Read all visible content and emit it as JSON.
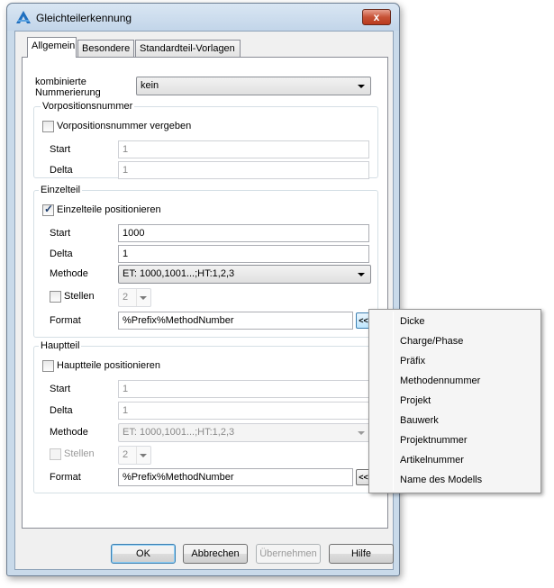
{
  "window": {
    "title": "Gleichteilerkennung",
    "close_glyph": "x"
  },
  "tabs": [
    {
      "label": "Allgemein"
    },
    {
      "label": "Besondere"
    },
    {
      "label": "Standardteil-Vorlagen"
    }
  ],
  "general": {
    "numbering_label": "kombinierte Nummerierung",
    "numbering_value": "kein"
  },
  "pre_position": {
    "group_title": "Vorpositionsnummer",
    "checkbox_label": "Vorpositionsnummer vergeben",
    "checked": false,
    "start_label": "Start",
    "start_value": "1",
    "delta_label": "Delta",
    "delta_value": "1"
  },
  "single_part": {
    "group_title": "Einzelteil",
    "checkbox_label": "Einzelteile positionieren",
    "checked": true,
    "start_label": "Start",
    "start_value": "1000",
    "delta_label": "Delta",
    "delta_value": "1",
    "method_label": "Methode",
    "method_value": "ET: 1000,1001...;HT:1,2,3",
    "digits_label": "Stellen",
    "digits_value": "2",
    "format_label": "Format",
    "format_value": "%Prefix%MethodNumber",
    "format_button": "<<"
  },
  "main_part": {
    "group_title": "Hauptteil",
    "checkbox_label": "Hauptteile positionieren",
    "checked": false,
    "start_label": "Start",
    "start_value": "1",
    "delta_label": "Delta",
    "delta_value": "1",
    "method_label": "Methode",
    "method_value": "ET: 1000,1001...;HT:1,2,3",
    "digits_label": "Stellen",
    "digits_value": "2",
    "format_label": "Format",
    "format_value": "%Prefix%MethodNumber",
    "format_button": "<<"
  },
  "buttons": {
    "ok": "OK",
    "cancel": "Abbrechen",
    "apply": "Übernehmen",
    "help": "Hilfe"
  },
  "context_menu": {
    "items": [
      {
        "label": "Dicke"
      },
      {
        "label": "Charge/Phase"
      },
      {
        "label": "Präfix"
      },
      {
        "label": "Methodennummer"
      },
      {
        "label": "Projekt"
      },
      {
        "label": "Bauwerk"
      },
      {
        "label": "Projektnummer"
      },
      {
        "label": "Artikelnummer"
      },
      {
        "label": "Name des Modells"
      }
    ]
  },
  "icons": {
    "app": "app-logo-icon",
    "close": "close-icon",
    "dropdown": "chevron-down-icon",
    "check": "checkmark-icon"
  }
}
